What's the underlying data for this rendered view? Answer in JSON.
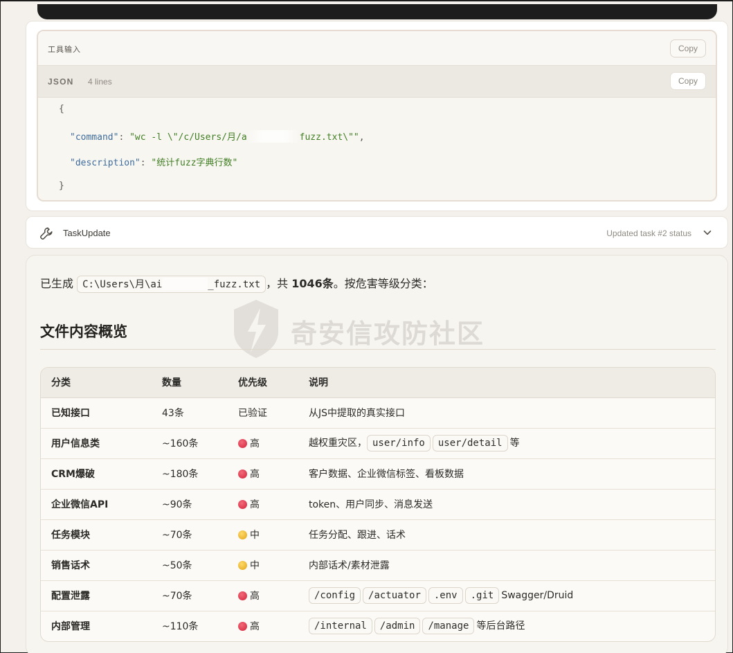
{
  "tool_input": {
    "title": "工具输入",
    "copy_label": "Copy",
    "json_block": {
      "lang": "JSON",
      "line_count": "4 lines",
      "copy_label": "Copy",
      "open_brace": "{",
      "close_brace": "}",
      "command_key": "\"command\"",
      "command_value_prefix": "\"wc -l \\\"/c/Users/月/a",
      "command_value_suffix": "fuzz.txt\\\"\"",
      "description_key": "\"description\"",
      "description_value": "\"统计fuzz字典行数\"",
      "colon": ": ",
      "comma": ","
    }
  },
  "task_update": {
    "name": "TaskUpdate",
    "status": "Updated task #2 status",
    "icon": "wrench-icon"
  },
  "response": {
    "intro_prefix": "已生成",
    "file_path_prefix": "C:\\Users\\月\\ai",
    "file_path_suffix": "_fuzz.txt",
    "intro_mid": "，共",
    "count": "1046条",
    "intro_suffix": "。按危害等级分类：",
    "heading": "文件内容概览",
    "watermark_text": "奇安信攻防社区",
    "table": {
      "headers": [
        "分类",
        "数量",
        "优先级",
        "说明"
      ],
      "rows": [
        {
          "category": "已知接口",
          "count": "43条",
          "priority": "已验证",
          "level": "",
          "desc_codes": [],
          "desc_text": "从JS中提取的真实接口"
        },
        {
          "category": "用户信息类",
          "count": "~160条",
          "priority": "高",
          "level": "red",
          "desc_prefix": "越权重灾区，",
          "desc_codes": [
            "user/info",
            "user/detail"
          ],
          "desc_text": "等"
        },
        {
          "category": "CRM爆破",
          "count": "~180条",
          "priority": "高",
          "level": "red",
          "desc_codes": [],
          "desc_text": "客户数据、企业微信标签、看板数据"
        },
        {
          "category": "企业微信API",
          "count": "~90条",
          "priority": "高",
          "level": "red",
          "desc_codes": [],
          "desc_text": "token、用户同步、消息发送"
        },
        {
          "category": "任务模块",
          "count": "~70条",
          "priority": "中",
          "level": "yellow",
          "desc_codes": [],
          "desc_text": "任务分配、跟进、话术"
        },
        {
          "category": "销售话术",
          "count": "~50条",
          "priority": "中",
          "level": "yellow",
          "desc_codes": [],
          "desc_text": "内部话术/素材泄露"
        },
        {
          "category": "配置泄露",
          "count": "~70条",
          "priority": "高",
          "level": "red",
          "desc_codes": [
            "/config",
            "/actuator",
            ".env",
            ".git"
          ],
          "desc_text": "Swagger/Druid"
        },
        {
          "category": "内部管理",
          "count": "~110条",
          "priority": "高",
          "level": "red",
          "desc_codes": [
            "/internal",
            "/admin",
            "/manage"
          ],
          "desc_text": "等后台路径"
        }
      ]
    }
  },
  "colors": {
    "high": "#d2243a",
    "medium": "#e0a417",
    "json_key": "#3d6b9c",
    "json_string": "#3f7d22"
  }
}
